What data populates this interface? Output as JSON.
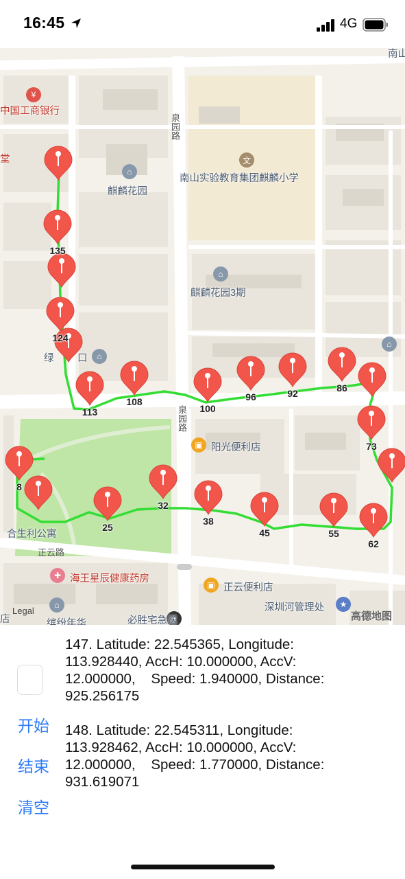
{
  "status_bar": {
    "time": "16:45",
    "network": "4G"
  },
  "map": {
    "labels": {
      "bank": "中国工商银行",
      "school": "南山实验教育集团麒麟小学",
      "qilin_garden": "麒麟花园",
      "qilin_garden_3": "麒麟花园3期",
      "quanyuan_road_top": "泉园路",
      "quanyuan_road_bottom": "泉园路",
      "sunshine_store": "阳光便利店",
      "hesheng_apartment": "合生利公寓",
      "zhengyun_road": "正云路",
      "pharmacy": "海王星辰健康药房",
      "zhengyun_store": "正云便利店",
      "river_office": "深圳河管理处",
      "pizza": "必胜宅急送",
      "fragment_tang": "堂",
      "fragment_lv": "绿",
      "fragment_kou": "口",
      "fragment_nanshan": "南山",
      "fragment_xunfen": "缤纷年华",
      "fragment_dian": "店"
    },
    "markers": [
      "135",
      "124",
      "113",
      "108",
      "100",
      "96",
      "92",
      "86",
      "73",
      "62",
      "55",
      "45",
      "38",
      "32",
      "25",
      "8"
    ],
    "legal": "Legal",
    "logo": "高德地图",
    "route_color": "#33dd33",
    "marker_color": "#f2554a"
  },
  "actions": {
    "start": "开始",
    "end": "结束",
    "clear": "清空"
  },
  "log": [
    "147. Latitude: 22.545365, Longitude: 113.928440, AccH: 10.000000, AccV: 12.000000,    Speed: 1.940000, Distance: 925.256175",
    "148. Latitude: 22.545311, Longitude: 113.928462, AccH: 10.000000, AccV: 12.000000,    Speed: 1.770000, Distance: 931.619071"
  ]
}
